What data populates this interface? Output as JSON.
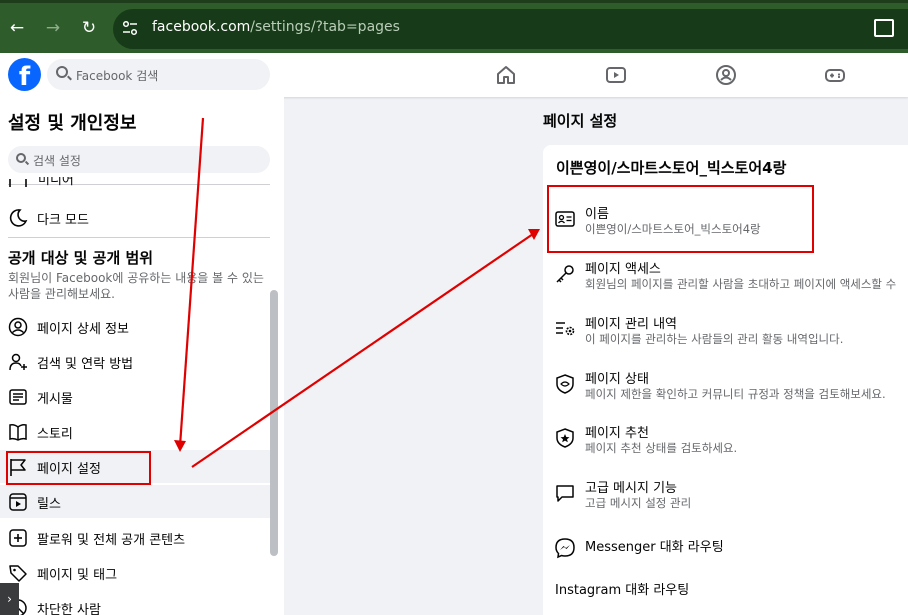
{
  "browser": {
    "url_host": "facebook.com",
    "url_path": "/settings/?tab=pages"
  },
  "fb_header": {
    "search_placeholder": "Facebook 검색",
    "nav_icons": [
      "home-icon",
      "video-icon",
      "groups-icon",
      "gaming-icon"
    ]
  },
  "settings": {
    "title": "설정 및 개인정보",
    "search_placeholder": "검색 설정",
    "partial_item": "미디어",
    "dark_mode": "다크 모드",
    "audience_heading": "공개 대상 및 공개 범위",
    "audience_desc": "회원님이 Facebook에 공유하는 내용을 볼 수 있는 사람을 관리해보세요.",
    "items": [
      {
        "label": "페이지 상세 정보",
        "icon": "person-icon"
      },
      {
        "label": "검색 및 연락 방법",
        "icon": "person-add-icon"
      },
      {
        "label": "게시물",
        "icon": "post-icon"
      },
      {
        "label": "스토리",
        "icon": "book-icon"
      },
      {
        "label": "페이지 설정",
        "icon": "flag-icon"
      },
      {
        "label": "릴스",
        "icon": "reels-icon"
      },
      {
        "label": "팔로워 및 전체 공개 콘텐츠",
        "icon": "plus-square-icon"
      },
      {
        "label": "페이지 및 태그",
        "icon": "tag-icon"
      },
      {
        "label": "차단한 사람",
        "icon": "blocked-icon"
      }
    ]
  },
  "page_settings": {
    "title": "페이지 설정",
    "page_name": "이쁜영이/스마트스토어_빅스토어4랑",
    "rows": [
      {
        "title": "이름",
        "desc": "이쁜영이/스마트스토어_빅스토어4랑",
        "icon": "id-card-icon"
      },
      {
        "title": "페이지 액세스",
        "desc": "회원님의 페이지를 관리할 사람을 초대하고 페이지에 액세스할 수",
        "icon": "key-icon"
      },
      {
        "title": "페이지 관리 내역",
        "desc": "이 페이지를 관리하는 사람들의 관리 활동 내역입니다.",
        "icon": "list-gear-icon"
      },
      {
        "title": "페이지 상태",
        "desc": "페이지 제한을 확인하고 커뮤니티 규정과 정책을 검토해보세요.",
        "icon": "shield-icon"
      },
      {
        "title": "페이지 추천",
        "desc": "페이지 추천 상태를 검토하세요.",
        "icon": "star-badge-icon"
      },
      {
        "title": "고급 메시지 기능",
        "desc": "고급 메시지 설정 관리",
        "icon": "chat-bubble-icon"
      }
    ],
    "messenger_routing": "Messenger 대화 라우팅",
    "instagram_routing": "Instagram 대화 라우팅"
  },
  "annotation_color": "#e00000"
}
